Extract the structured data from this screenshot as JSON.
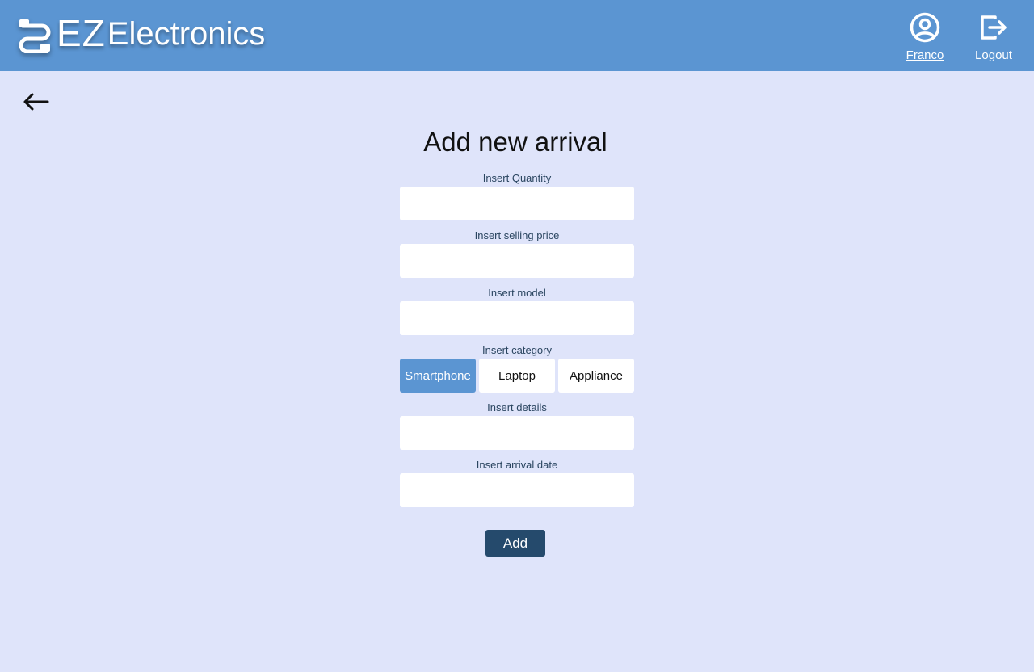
{
  "header": {
    "logo": {
      "ez": "EZ",
      "rest": "Electronics",
      "icon": "cable-connector-icon"
    },
    "user": {
      "label": "Franco",
      "icon": "user-circle-icon"
    },
    "logout": {
      "label": "Logout",
      "icon": "logout-icon"
    }
  },
  "nav": {
    "back_icon": "arrow-left-icon"
  },
  "form": {
    "title": "Add new arrival",
    "quantity": {
      "label": "Insert Quantity",
      "value": ""
    },
    "selling_price": {
      "label": "Insert selling price",
      "value": ""
    },
    "model": {
      "label": "Insert model",
      "value": ""
    },
    "category": {
      "label": "Insert category",
      "options": [
        "Smartphone",
        "Laptop",
        "Appliance"
      ],
      "selected": "Smartphone"
    },
    "details": {
      "label": "Insert details",
      "value": ""
    },
    "arrival_date": {
      "label": "Insert arrival date",
      "value": ""
    },
    "submit_label": "Add"
  },
  "colors": {
    "header_bg": "#5b95d2",
    "page_bg": "#dfe4fa",
    "selected_category": "#5b95d2",
    "submit_bg": "#254a6c"
  }
}
